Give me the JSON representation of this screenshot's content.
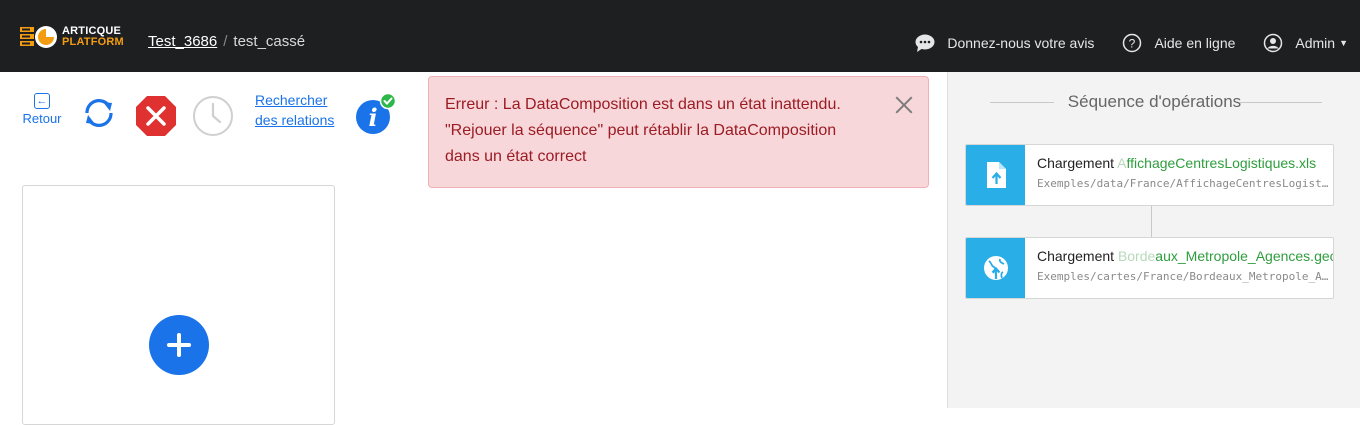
{
  "header": {
    "logo": {
      "line1": "ARTICQUE",
      "line2": "PLATFORM"
    },
    "breadcrumb": {
      "project": "Test_3686",
      "separator": "/",
      "current": "test_cassé"
    },
    "feedback_label": "Donnez-nous votre avis",
    "help_label": "Aide en ligne",
    "user_label": "Admin",
    "icons": {
      "feedback": "chat-bubble-icon",
      "help": "question-circle-icon",
      "user": "user-circle-icon",
      "caret": "caret-down-icon"
    }
  },
  "toolbar": {
    "back_label": "Retour",
    "search_relations_line1": "Rechercher",
    "search_relations_line2": "des relations",
    "icons": [
      "back-icon",
      "refresh-icon",
      "stop-icon",
      "history-icon",
      "info-icon"
    ]
  },
  "alert": {
    "line1": "Erreur : La DataComposition est dans un état inattendu.",
    "line2": "\"Rejouer la séquence\" peut rétablir la DataComposition",
    "line3": "dans un état correct"
  },
  "sequence": {
    "title": "Séquence d'opérations",
    "operations": [
      {
        "label": "Chargement",
        "file_faded": "A",
        "file": "ffichageCentresLogistiques.xls",
        "path": "Exemples/data/France/AffichageCentresLogistiques.xls",
        "icon": "file-upload-icon"
      },
      {
        "label": "Chargement",
        "file_faded": "Borde",
        "file": "aux_Metropole_Agences.geojs",
        "path": "Exemples/cartes/France/Bordeaux_Metropole_Agences.geojson",
        "icon": "globe-upload-icon"
      }
    ]
  },
  "colors": {
    "topbar": "#1e1f21",
    "accent": "#1a73e8",
    "alert_bg": "#f8d7da",
    "alert_text": "#9b1c24",
    "op_icon_bg": "#29aee8",
    "file_green": "#2e9e3d",
    "stop_red": "#e03131",
    "info_badge_green": "#2eb84b"
  }
}
